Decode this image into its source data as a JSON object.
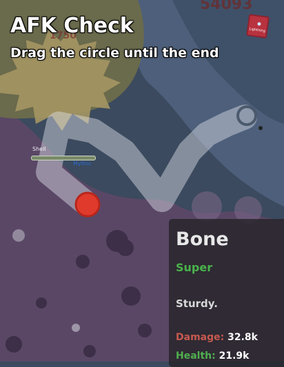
{
  "afk": {
    "title": "AFK Check",
    "subtitle": "Drag the circle until the end"
  },
  "background": {
    "score": "54093",
    "ghost_label": "1750",
    "lightning_card_label": "Lightning"
  },
  "player": {
    "name": "Shell",
    "rarity": "Mythic"
  },
  "tooltip": {
    "name": "Bone",
    "rarity": "Super",
    "description": "Sturdy.",
    "damage_label": "Damage:",
    "damage_value": "32.8k",
    "health_label": "Health:",
    "health_value": "21.9k"
  },
  "colors": {
    "path": "#dfe3ea",
    "handle": "#e03a2c",
    "rarity_super": "#49b34b",
    "damage": "#c6594f",
    "health": "#4fb04f"
  },
  "icons": {
    "drag_handle": "red-circle-icon",
    "end_target": "ring-icon",
    "card": "lightning-card-icon"
  }
}
